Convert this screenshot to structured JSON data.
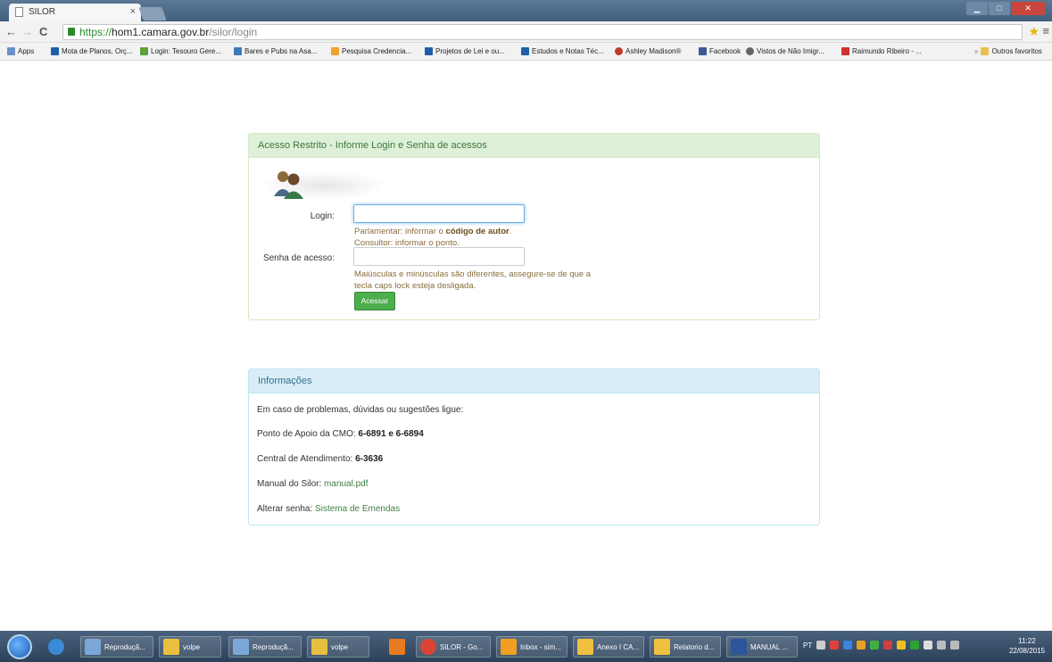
{
  "browser": {
    "tab_title": "SILOR",
    "url_scheme": "https://",
    "url_host": "hom1.camara.gov.br",
    "url_path": "/silor/login"
  },
  "bookmarks": [
    {
      "label": "Apps",
      "color": "#6b8fc7"
    },
    {
      "label": "Mota de Planos, Orç...",
      "color": "#1f5fa8"
    },
    {
      "label": "Login: Tesouro Gere...",
      "color": "#5aa03c"
    },
    {
      "label": "Bares e Pubs na Asa...",
      "color": "#3d7ab8"
    },
    {
      "label": "Pesquisa Credencia...",
      "color": "#f0a030"
    },
    {
      "label": "Projetos de Lei e ou...",
      "color": "#1f5fa8"
    },
    {
      "label": "Estudos e Notas Téc...",
      "color": "#1f5fa8"
    },
    {
      "label": "Ashley Madison®",
      "color": "#c0392b"
    },
    {
      "label": "Facebook",
      "color": "#3b5998"
    },
    {
      "label": "Vistos de Não Imigr...",
      "color": "#666666"
    },
    {
      "label": "Raimundo Ribeiro - ...",
      "color": "#d32f2f"
    }
  ],
  "bookmarks_other": "Outros favoritos",
  "login_panel": {
    "heading": "Acesso Restrito - Informe Login e Senha de acessos",
    "login_label": "Login:",
    "login_help_prefix": "Parlamentar: informar o ",
    "login_help_bold": "código de autor",
    "login_help_suffix": ".",
    "login_help_line2": "Consultor: informar o ponto.",
    "password_label": "Senha de acesso:",
    "password_help_line1": "Maiúsculas e minúsculas são diferentes, assegure-se de que a",
    "password_help_line2": "tecla caps lock esteja desligada.",
    "submit_label": "Acessar"
  },
  "info_panel": {
    "heading": "Informações",
    "intro": "Em caso de problemas, dúvidas ou sugestões ligue:",
    "cmo_label": "Ponto de Apoio da CMO: ",
    "cmo_value": "6-6891 e 6-6894",
    "central_label": "Central de Atendimento: ",
    "central_value": "6-3636",
    "manual_label": "Manual do Silor: ",
    "manual_link": "manual.pdf",
    "password_label": "Alterar senha: ",
    "password_link": "Sistema de Emendas"
  },
  "taskbar": {
    "items": [
      {
        "label": "Reproduçã...",
        "color": "#7aa7d8"
      },
      {
        "label": "volpe",
        "color": "#e8c040"
      },
      {
        "label": "Reproduçã...",
        "color": "#7aa7d8"
      },
      {
        "label": "volpe",
        "color": "#e8c040"
      },
      {
        "label": "",
        "color": "#e87a20"
      },
      {
        "label": "SILOR - Go...",
        "color": "#db4437"
      },
      {
        "label": "Inbox - sim...",
        "color": "#f0a020"
      },
      {
        "label": "Anexo I CA...",
        "color": "#f0c040"
      },
      {
        "label": "Relatorio d...",
        "color": "#f0c040"
      },
      {
        "label": "MANUAL ...",
        "color": "#2b579a"
      }
    ],
    "lang": "PT",
    "time": "11:22",
    "date": "22/08/2015"
  }
}
